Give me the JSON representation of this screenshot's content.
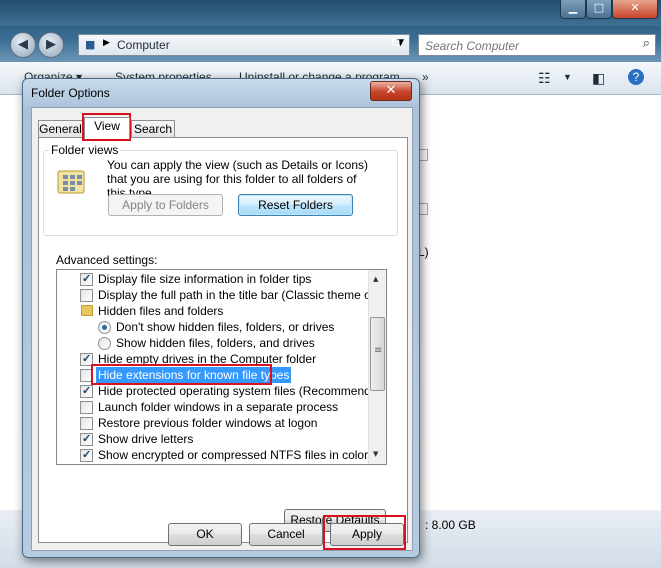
{
  "explorer": {
    "address": "Computer",
    "search_placeholder": "Search Computer",
    "toolbar": {
      "organize": "Organize ▾",
      "system_properties": "System properties",
      "uninstall": "Uninstall or change a program",
      "more": "»"
    },
    "status_size": ": 8.00 GB",
    "drive_fragment": "L)"
  },
  "dialog": {
    "title": "Folder Options",
    "close": "✕",
    "tabs": [
      {
        "label": "General"
      },
      {
        "label": "View",
        "active": true
      },
      {
        "label": "Search"
      }
    ],
    "folder_views": {
      "title": "Folder views",
      "description": "You can apply the view (such as Details or Icons) that you are using for this folder to all folders of this type.",
      "apply_to_folders": "Apply to Folders",
      "reset_folders": "Reset Folders"
    },
    "advanced_label": "Advanced settings:",
    "advanced_items": [
      {
        "label": "Display file size information in folder tips",
        "kind": "checkbox",
        "checked": true
      },
      {
        "label": "Display the full path in the title bar (Classic theme only)",
        "kind": "checkbox",
        "checked": false
      },
      {
        "label": "Hidden files and folders",
        "kind": "folder"
      },
      {
        "label": "Don't show hidden files, folders, or drives",
        "kind": "radio",
        "checked": true
      },
      {
        "label": "Show hidden files, folders, and drives",
        "kind": "radio",
        "checked": false
      },
      {
        "label": "Hide empty drives in the Computer folder",
        "kind": "checkbox",
        "checked": true
      },
      {
        "label": "Hide extensions for known file types",
        "kind": "checkbox",
        "checked": false,
        "selected": true
      },
      {
        "label": "Hide protected operating system files (Recommended)",
        "kind": "checkbox",
        "checked": true
      },
      {
        "label": "Launch folder windows in a separate process",
        "kind": "checkbox",
        "checked": false
      },
      {
        "label": "Restore previous folder windows at logon",
        "kind": "checkbox",
        "checked": false
      },
      {
        "label": "Show drive letters",
        "kind": "checkbox",
        "checked": true
      },
      {
        "label": "Show encrypted or compressed NTFS files in color",
        "kind": "checkbox",
        "checked": true
      }
    ],
    "restore_defaults": "Restore Defaults",
    "ok": "OK",
    "cancel": "Cancel",
    "apply": "Apply"
  },
  "colors": {
    "highlight": "#d9101f",
    "selection": "#3399ff"
  }
}
